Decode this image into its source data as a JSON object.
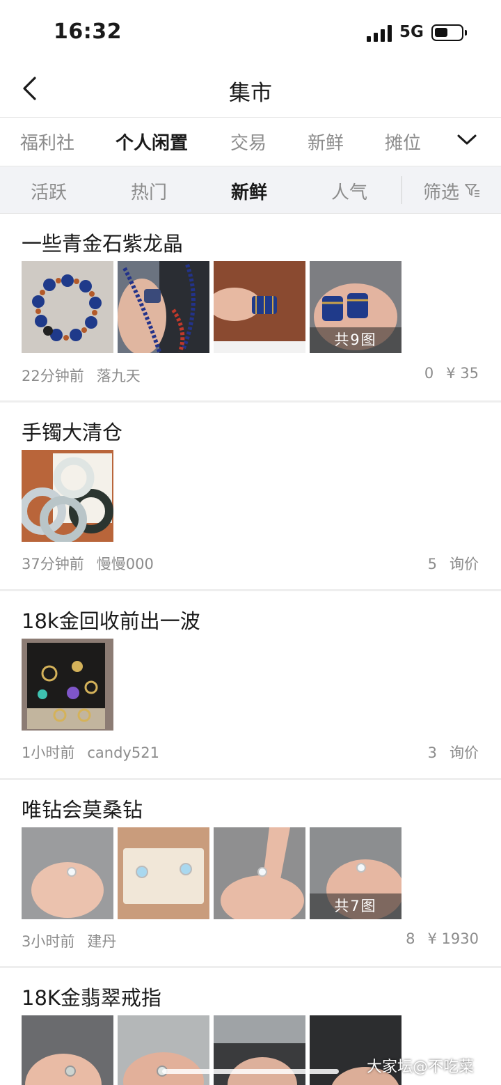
{
  "status": {
    "time": "16:32",
    "network": "5G"
  },
  "nav": {
    "title": "集市"
  },
  "tabs": [
    {
      "label": "福利社"
    },
    {
      "label": "个人闲置"
    },
    {
      "label": "交易"
    },
    {
      "label": "新鲜"
    },
    {
      "label": "摊位"
    }
  ],
  "sort": {
    "options": [
      {
        "label": "活跃"
      },
      {
        "label": "热门"
      },
      {
        "label": "新鲜"
      },
      {
        "label": "人气"
      }
    ],
    "filter_label": "筛选"
  },
  "posts": [
    {
      "title": "一些青金石紫龙晶",
      "images": [
        "lapis-bracelet",
        "lapis-necklace",
        "lapis-beads",
        "lapis-beads-hand"
      ],
      "badge": "共9图",
      "time": "22分钟前",
      "author": "落九天",
      "count": "0",
      "price": "¥ 35"
    },
    {
      "title": "手镯大清仓",
      "images": [
        "jade-bangles"
      ],
      "time": "37分钟前",
      "author": "慢慢000",
      "count": "5",
      "price": "询价"
    },
    {
      "title": "18k金回收前出一波",
      "images": [
        "gold-jewelry-box"
      ],
      "time": "1小时前",
      "author": "candy521",
      "count": "3",
      "price": "询价"
    },
    {
      "title": "唯钻会莫桑钻",
      "images": [
        "ring-hand",
        "ring-box",
        "ring-finger",
        "ring-finger-2"
      ],
      "badge": "共7图",
      "time": "3小时前",
      "author": "建丹",
      "count": "8",
      "price": "¥ 1930"
    },
    {
      "title": "18K金翡翠戒指",
      "images": [
        "jade-ring-hand",
        "jade-ring-hand-2",
        "jade-ring-3",
        "jade-ring-4"
      ]
    }
  ],
  "watermark": "大家坛@不吃菜",
  "icons": {
    "back": "chevron-left-icon",
    "more_tabs": "chevron-down-icon",
    "filter": "filter-icon"
  },
  "colors": {
    "text": "#1a1a1a",
    "muted": "#8c8c8c",
    "sortbar_bg": "#f2f3f6"
  }
}
